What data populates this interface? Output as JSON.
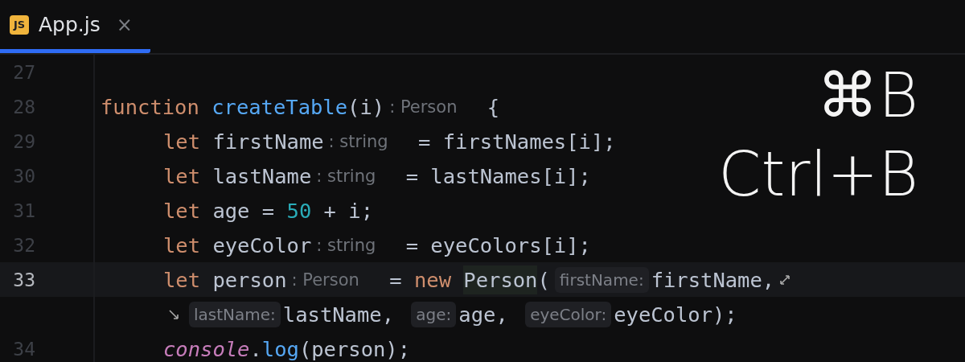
{
  "tabs": [
    {
      "label": "App.js",
      "badge": "JS",
      "selected": true,
      "close": "×"
    }
  ],
  "lines": [
    {
      "number": "27",
      "current": false
    },
    {
      "number": "28",
      "current": false,
      "tokens": [
        {
          "kind": "keyword",
          "text": "function "
        },
        {
          "kind": "function",
          "text": "createTable"
        },
        {
          "kind": "plain",
          "text": "(i)"
        },
        {
          "kind": "type-hint",
          "text": ": Person"
        },
        {
          "kind": "plain",
          "text": " {"
        }
      ],
      "children": [
        {
          "number": "29",
          "current": false,
          "tokens": [
            {
              "kind": "keyword",
              "text": "let"
            },
            {
              "kind": "plain",
              "text": " firstName"
            },
            {
              "kind": "type-hint",
              "text": ": string"
            },
            {
              "kind": "plain",
              "text": " = firstNames[i];"
            }
          ]
        },
        {
          "number": "30",
          "current": false,
          "tokens": [
            {
              "kind": "keyword",
              "text": "let"
            },
            {
              "kind": "plain",
              "text": " lastName"
            },
            {
              "kind": "type-hint",
              "text": ": string"
            },
            {
              "kind": "plain",
              "text": " = lastNames[i];"
            }
          ]
        },
        {
          "number": "31",
          "current": false,
          "tokens": [
            {
              "kind": "keyword",
              "text": "let"
            },
            {
              "kind": "plain",
              "text": " age = "
            },
            {
              "kind": "number",
              "text": "50"
            },
            {
              "kind": "plain",
              "text": " + i;"
            }
          ]
        },
        {
          "number": "32",
          "current": false,
          "tokens": [
            {
              "kind": "keyword",
              "text": "let"
            },
            {
              "kind": "plain",
              "text": " eyeColor"
            },
            {
              "kind": "type-hint",
              "text": ": string"
            },
            {
              "kind": "plain",
              "text": " = eyeColors[i];"
            }
          ]
        },
        {
          "number": "33",
          "current": true,
          "tokens": [
            {
              "kind": "keyword",
              "text": "let"
            },
            {
              "kind": "plain",
              "text": " person"
            },
            {
              "kind": "type-hint",
              "text": ": Person"
            },
            {
              "kind": "plain",
              "text": " = "
            },
            {
              "kind": "keyword",
              "text": "new "
            },
            {
              "kind": "caret-symbol",
              "text": "Person"
            },
            {
              "kind": "plain",
              "text": "("
            },
            {
              "kind": "param-hint",
              "text": "firstName:"
            },
            {
              "kind": "plain",
              "text": "firstName,"
            },
            {
              "kind": "wrap-out"
            }
          ],
          "continuation": [
            {
              "kind": "wrap-in"
            },
            {
              "kind": "param-hint",
              "text": "lastName:"
            },
            {
              "kind": "plain",
              "text": "lastName, "
            },
            {
              "kind": "param-hint",
              "text": "age:"
            },
            {
              "kind": "plain",
              "text": "age, "
            },
            {
              "kind": "param-hint",
              "text": "eyeColor:"
            },
            {
              "kind": "plain",
              "text": "eyeColor);"
            }
          ]
        },
        {
          "number": "34",
          "current": false,
          "tokens": [
            {
              "kind": "object",
              "text": "console"
            },
            {
              "kind": "plain",
              "text": "."
            },
            {
              "kind": "function",
              "text": "log"
            },
            {
              "kind": "plain",
              "text": "(person);"
            }
          ]
        }
      ]
    }
  ],
  "shortcuts": [
    "⌘B",
    "Ctrl+B"
  ]
}
